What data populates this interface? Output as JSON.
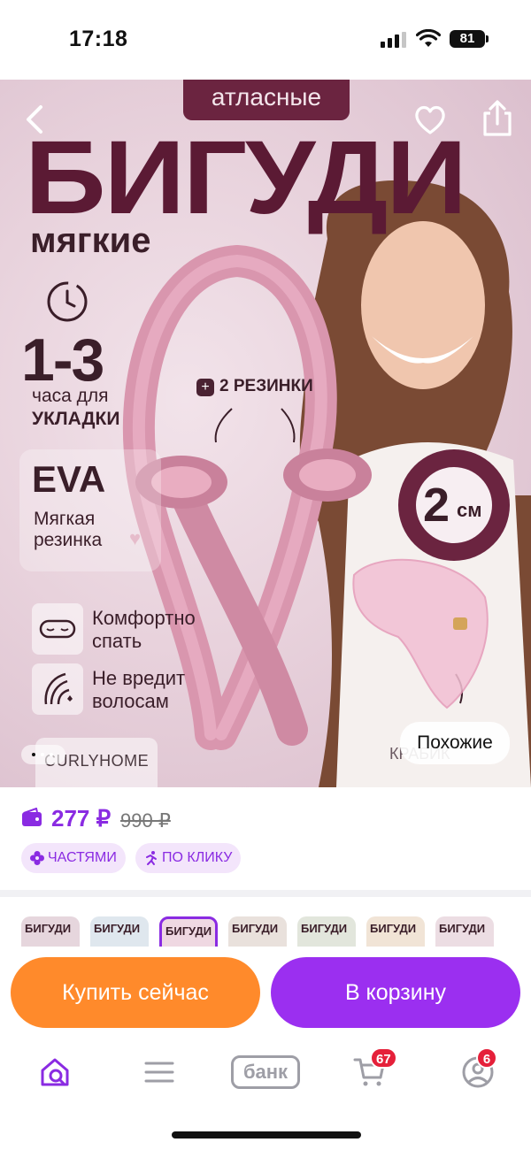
{
  "status_bar": {
    "time": "17:18",
    "battery": "81"
  },
  "hero": {
    "pill": "атласные",
    "title": "БИГУДИ",
    "subtitle": "мягкие",
    "hours_value": "1-3",
    "hours_line1": "часа для",
    "hours_line2": "УКЛАДКИ",
    "eva_title": "EVA",
    "eva_line1": "Мягкая",
    "eva_line2": "резинка",
    "feature1_line1": "Комфортно",
    "feature1_line2": "спать",
    "feature2_line1": "Не вредит",
    "feature2_line2": "волосам",
    "elastics": "2 РЕЗИНКИ",
    "diameter_value": "2",
    "diameter_unit": "см",
    "brand": "CURLYHOME",
    "clip_label": "КРАБИК",
    "similar_label": "Похожие",
    "colors": {
      "maroon": "#5b1a34",
      "pink_bg": "#e8d2dc"
    }
  },
  "price": {
    "current": "277 ₽",
    "old": "990 ₽",
    "chip_parts": "ЧАСТЯМИ",
    "chip_click": "ПО КЛИКУ",
    "accent": "#8a2be2"
  },
  "thumbnails": [
    {
      "label": "БИГУДИ",
      "active": false
    },
    {
      "label": "БИГУДИ",
      "active": false
    },
    {
      "label": "БИГУДИ",
      "active": true
    },
    {
      "label": "БИГУДИ",
      "active": false
    },
    {
      "label": "БИГУДИ",
      "active": false
    },
    {
      "label": "БИГУДИ",
      "active": false
    },
    {
      "label": "БИГУДИ",
      "active": false
    }
  ],
  "actions": {
    "buy_now": "Купить сейчас",
    "to_cart": "В корзину",
    "buy_color": "#ff8a2b",
    "cart_color": "#9b2ff0"
  },
  "tabbar": {
    "bank_label": "банк",
    "cart_badge": "67",
    "profile_badge": "6",
    "icons": [
      "home-search-icon",
      "menu-icon",
      "bank-icon",
      "cart-icon",
      "profile-icon"
    ]
  }
}
